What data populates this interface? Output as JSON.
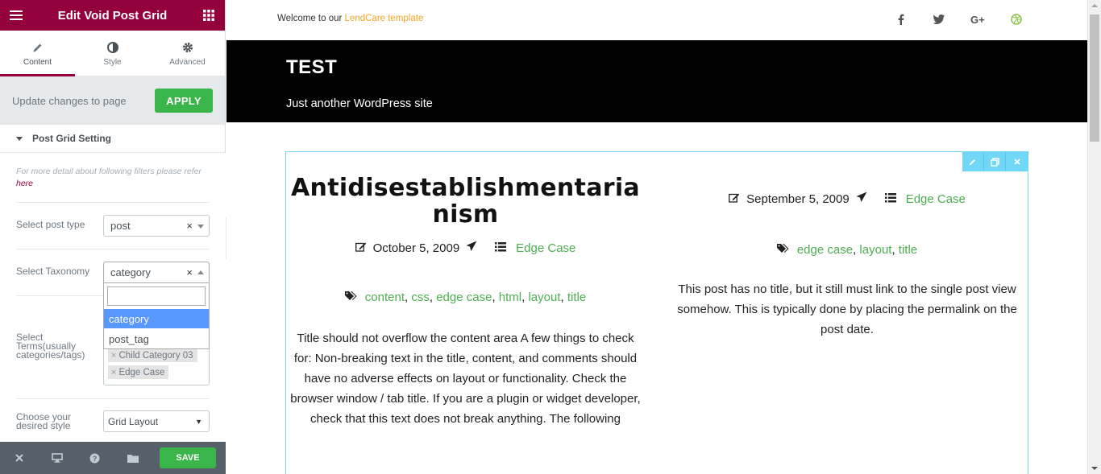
{
  "panel": {
    "title": "Edit Void Post Grid",
    "tabs": [
      {
        "label": "Content",
        "icon": "pencil-icon"
      },
      {
        "label": "Style",
        "icon": "contrast-icon"
      },
      {
        "label": "Advanced",
        "icon": "gear-icon"
      }
    ],
    "apply_text": "Update changes to page",
    "apply_label": "APPLY",
    "section_title": "Post Grid Setting",
    "note_text": "For more detail about following filters please refer",
    "note_link": "here",
    "controls": {
      "post_type_label": "Select post type",
      "post_type_value": "post",
      "taxonomy_label": "Select Taxonomy",
      "taxonomy_value": "category",
      "taxonomy_options": [
        "category",
        "post_tag"
      ],
      "terms_label": "Select Terms(usually categories/tags)",
      "terms_tags": [
        "Child Category 03",
        "Edge Case"
      ],
      "style_label": "Choose your desired style",
      "style_value": "Grid Layout"
    },
    "footer": {
      "save_label": "SAVE"
    },
    "colors": {
      "brand": "#93003c",
      "apply": "#39b54a"
    }
  },
  "site": {
    "welcome_prefix": "Welcome to our",
    "welcome_brand": "LendCare template",
    "social": [
      "facebook-icon",
      "twitter-icon",
      "google-plus-icon",
      "dribbble-icon"
    ],
    "title": "TEST",
    "tagline": "Just another WordPress site"
  },
  "posts": [
    {
      "title": "Antidisestablishmentarianism",
      "date": "October 5, 2009",
      "category": "Edge Case",
      "tags": [
        "content",
        "css",
        "edge case",
        "html",
        "layout",
        "title"
      ],
      "excerpt": "Title should not overflow the content area A few things to check for: Non-breaking text in the title, content, and comments should have no adverse effects on layout or functionality. Check the browser window / tab title. If you are a plugin or widget developer, check that this text does not break anything. The following"
    },
    {
      "title": "",
      "date": "September 5, 2009",
      "category": "Edge Case",
      "tags": [
        "edge case",
        "layout",
        "title"
      ],
      "excerpt": "This post has no title, but it still must link to the single post view somehow. This is typically done by placing the permalink on the post date."
    }
  ]
}
